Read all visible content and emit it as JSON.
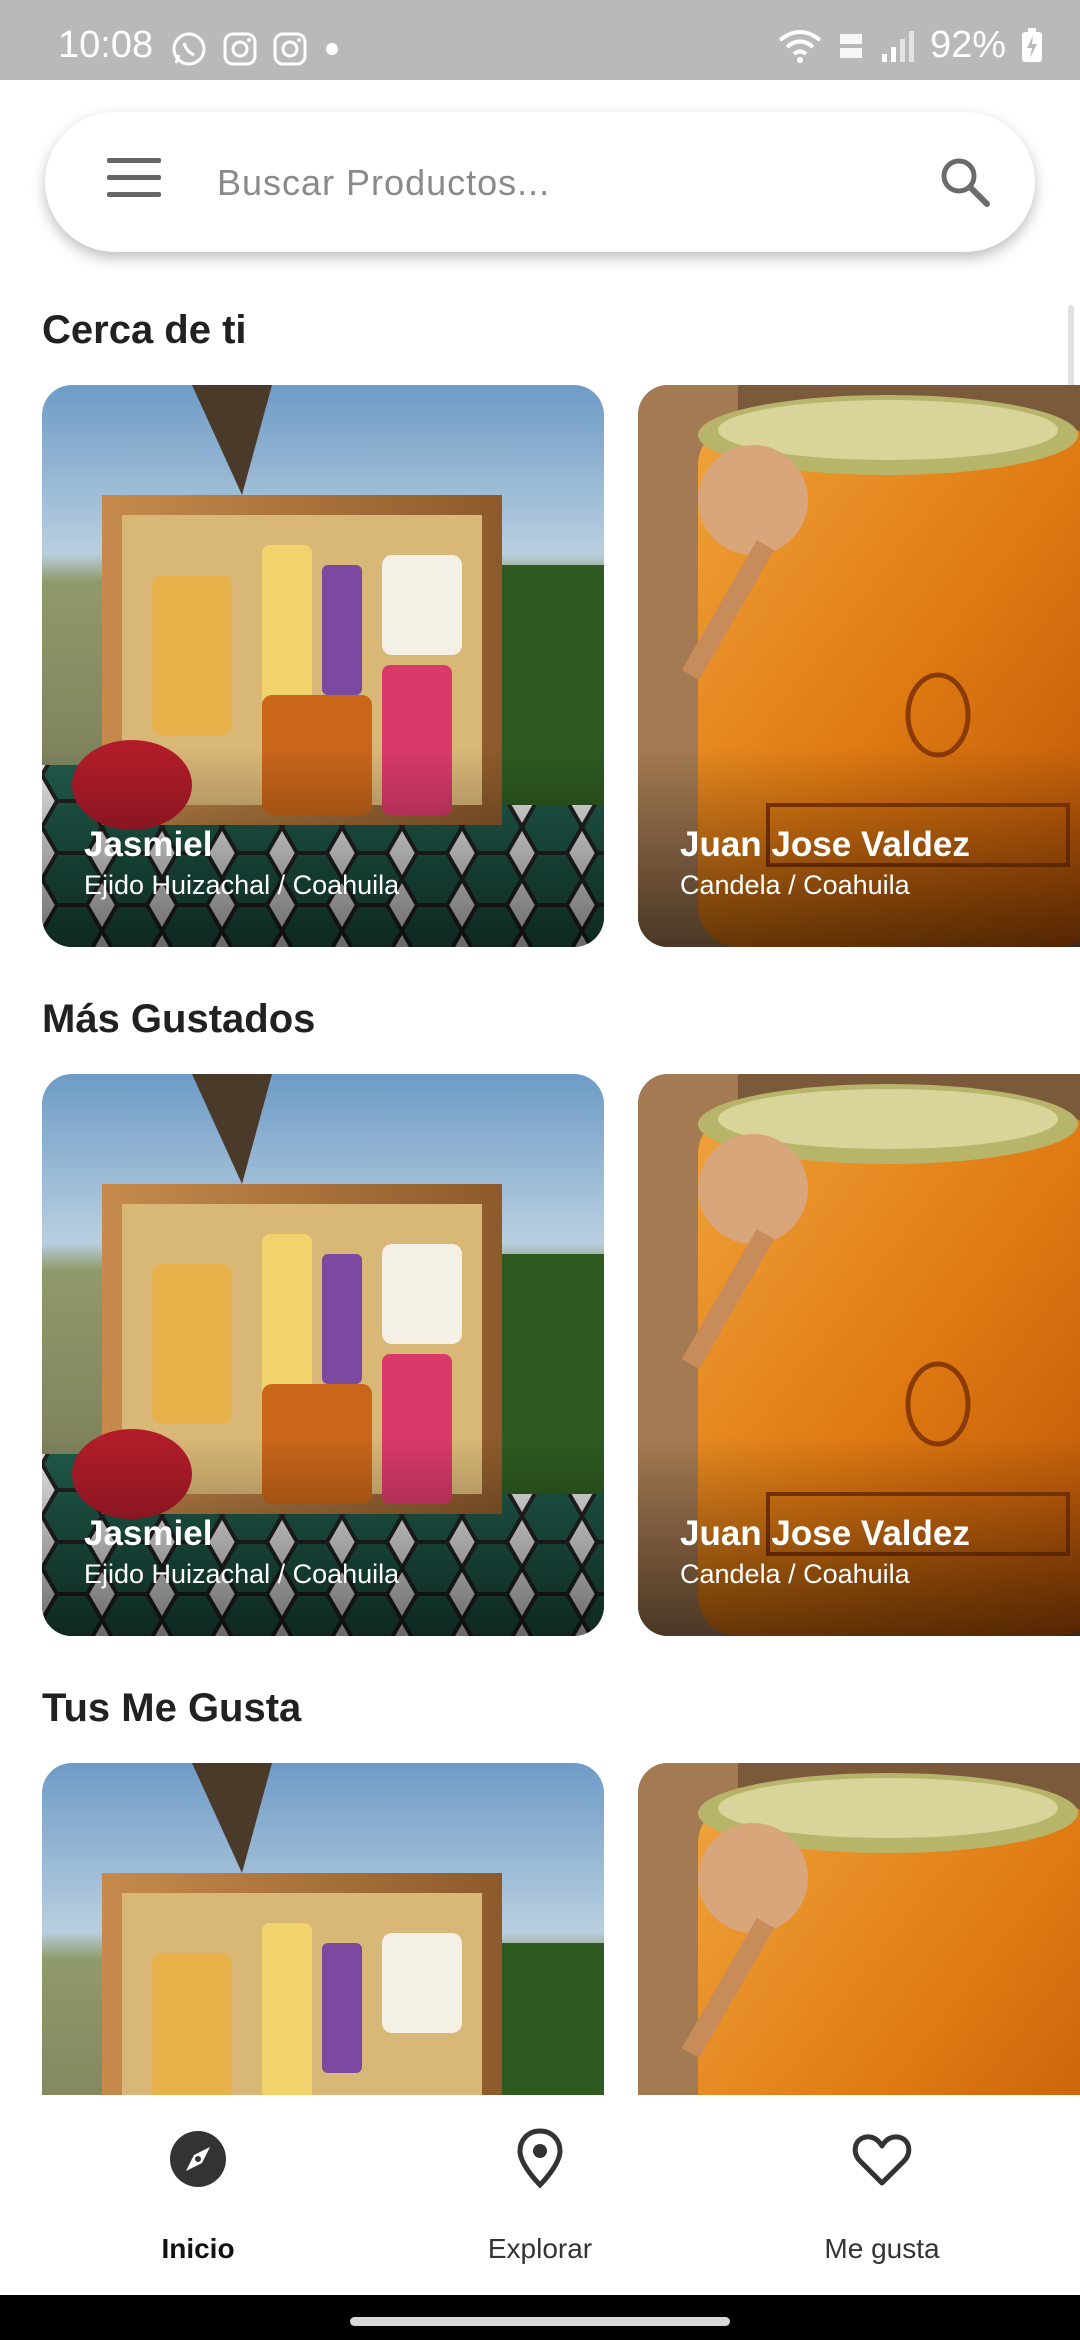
{
  "status_bar": {
    "time": "10:08",
    "battery": "92%",
    "left_icons": [
      "whatsapp-icon",
      "instagram-icon",
      "instagram-icon",
      "dot-icon"
    ],
    "right_icons": [
      "wifi-icon",
      "volte-icon",
      "signal-icon",
      "battery-charging-icon"
    ]
  },
  "search": {
    "placeholder": "Buscar Productos..."
  },
  "sections": {
    "nearby": {
      "title": "Cerca de ti"
    },
    "popular": {
      "title": "Más Gustados"
    },
    "likes": {
      "title": "Tus Me Gusta"
    }
  },
  "cards": [
    {
      "name": "Jasmiel",
      "location": "Ejido Huizachal / Coahuila"
    },
    {
      "name": "Juan Jose Valdez",
      "location": "Candela / Coahuila"
    }
  ],
  "bottom_nav": {
    "items": [
      {
        "label": "Inicio",
        "icon": "compass-icon",
        "active": true
      },
      {
        "label": "Explorar",
        "icon": "location-pin-icon",
        "active": false
      },
      {
        "label": "Me gusta",
        "icon": "heart-icon",
        "active": false
      }
    ]
  },
  "colors": {
    "status_bar": "#b9b9b9",
    "honey": "#e07a12",
    "text_primary": "#212121"
  }
}
